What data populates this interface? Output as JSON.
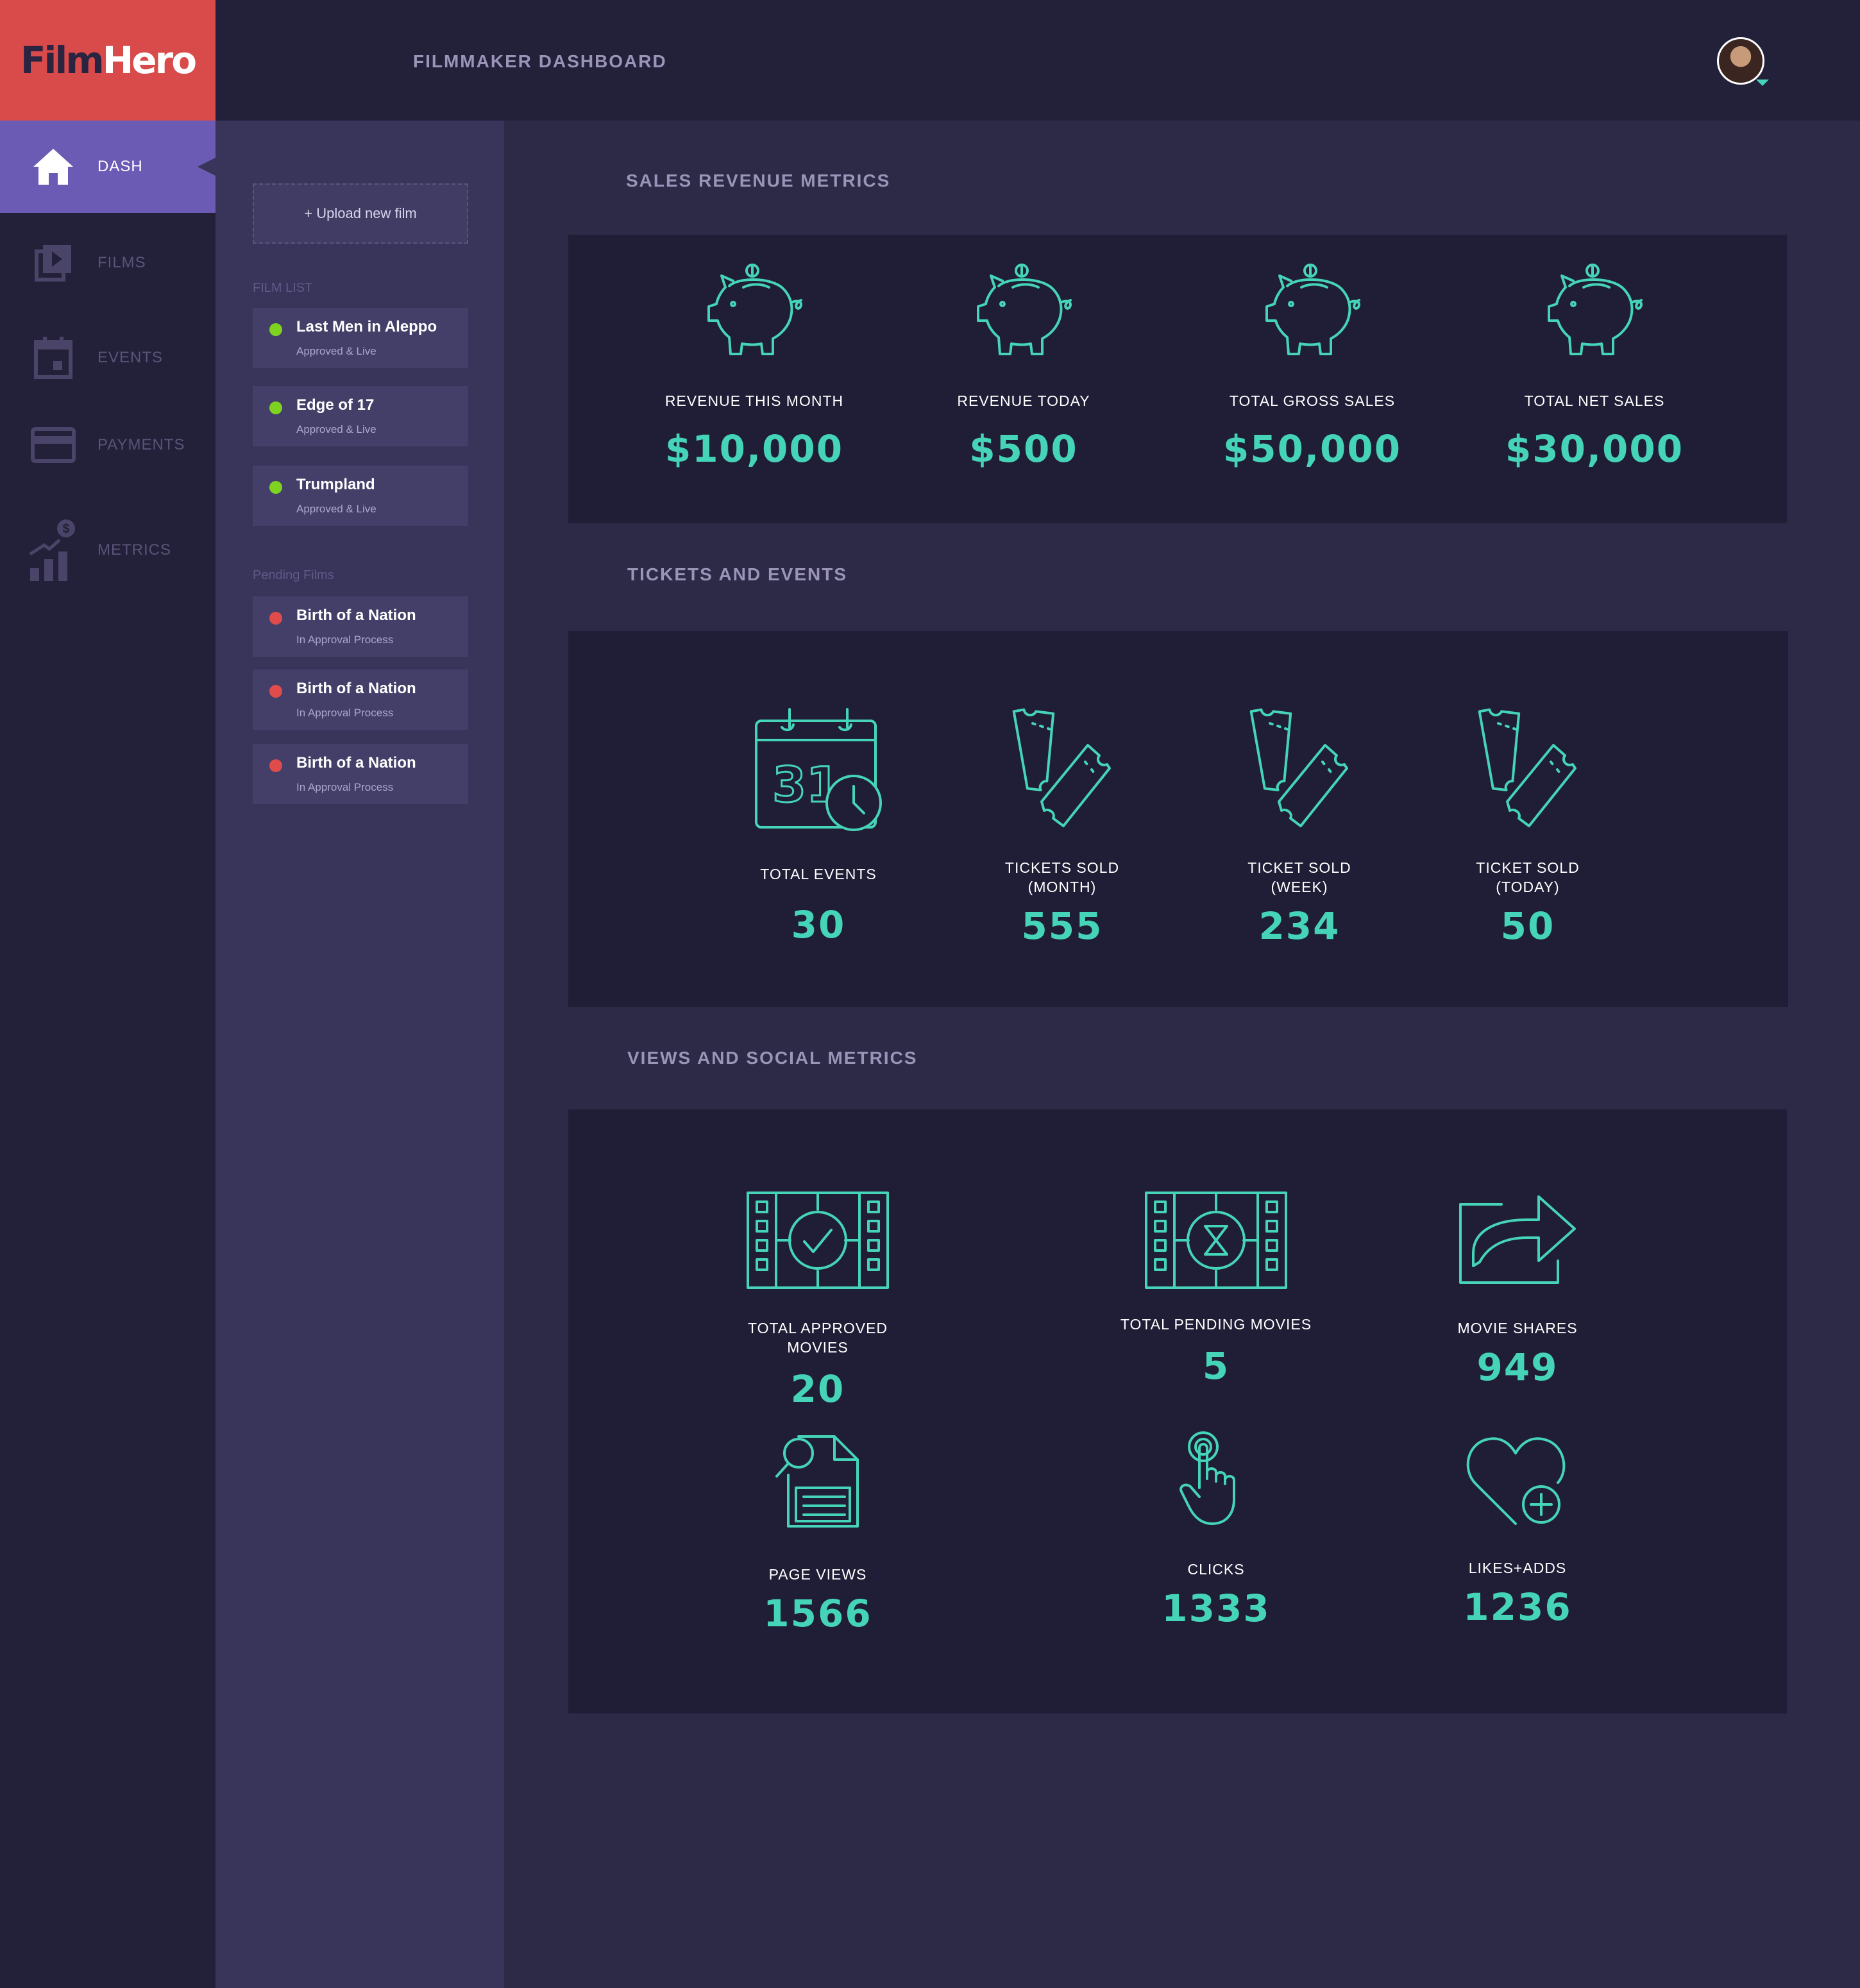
{
  "app": {
    "logo_film": "Film",
    "logo_hero": "Hero",
    "page_title": "FILMMAKER DASHBOARD"
  },
  "nav": [
    {
      "label": "DASH",
      "icon": "home-icon",
      "active": true
    },
    {
      "label": "FILMS",
      "icon": "films-icon",
      "active": false
    },
    {
      "label": "EVENTS",
      "icon": "calendar-icon",
      "active": false
    },
    {
      "label": "PAYMENTS",
      "icon": "credit-card-icon",
      "active": false
    },
    {
      "label": "METRICS",
      "icon": "metrics-chart-icon",
      "active": false
    }
  ],
  "sidebar": {
    "upload_label": "+ Upload new film",
    "film_list_caption": "FILM LIST",
    "pending_caption": "Pending Films",
    "films": [
      {
        "title": "Last Men in Aleppo",
        "status": "Approved & Live"
      },
      {
        "title": "Edge of 17",
        "status": "Approved & Live"
      },
      {
        "title": "Trumpland",
        "status": "Approved & Live"
      }
    ],
    "pending": [
      {
        "title": "Birth of a Nation",
        "status": "In Approval Process"
      },
      {
        "title": "Birth of a Nation",
        "status": "In Approval Process"
      },
      {
        "title": "Birth of a Nation",
        "status": "In Approval Process"
      }
    ]
  },
  "colors": {
    "accent": "#45d4b8",
    "approved": "#7ed321",
    "pending": "#e04b4b",
    "brand_red": "#d94b4b",
    "active_nav": "#6b5bb5"
  },
  "sales": {
    "title": "SALES REVENUE METRICS",
    "metrics": [
      {
        "label": "REVENUE THIS MONTH",
        "value": "$10,000",
        "icon": "piggy-bank-icon"
      },
      {
        "label": "REVENUE TODAY",
        "value": "$500",
        "icon": "piggy-bank-icon"
      },
      {
        "label": "TOTAL GROSS SALES",
        "value": "$50,000",
        "icon": "piggy-bank-icon"
      },
      {
        "label": "TOTAL NET SALES",
        "value": "$30,000",
        "icon": "piggy-bank-icon"
      }
    ]
  },
  "tickets": {
    "title": "TICKETS AND EVENTS",
    "calendar_day": "31",
    "metrics": [
      {
        "label": "TOTAL EVENTS",
        "value": "30",
        "icon": "calendar-clock-icon"
      },
      {
        "label": "TICKETS SOLD\n(MONTH)",
        "value": "555",
        "icon": "tickets-icon"
      },
      {
        "label": "TICKET SOLD\n(WEEK)",
        "value": "234",
        "icon": "tickets-icon"
      },
      {
        "label": "TICKET SOLD\n(TODAY)",
        "value": "50",
        "icon": "tickets-icon"
      }
    ]
  },
  "views": {
    "title": "VIEWS AND SOCIAL METRICS",
    "metrics": [
      {
        "label": "TOTAL APPROVED MOVIES",
        "value": "20",
        "icon": "film-check-icon"
      },
      {
        "label": "TOTAL PENDING MOVIES",
        "value": "5",
        "icon": "film-hourglass-icon"
      },
      {
        "label": "MOVIE SHARES",
        "value": "949",
        "icon": "share-icon"
      },
      {
        "label": "PAGE VIEWS",
        "value": "1566",
        "icon": "document-search-icon"
      },
      {
        "label": "CLICKS",
        "value": "1333",
        "icon": "click-hand-icon"
      },
      {
        "label": "LIKES+ADDS",
        "value": "1236",
        "icon": "heart-plus-icon"
      }
    ]
  }
}
